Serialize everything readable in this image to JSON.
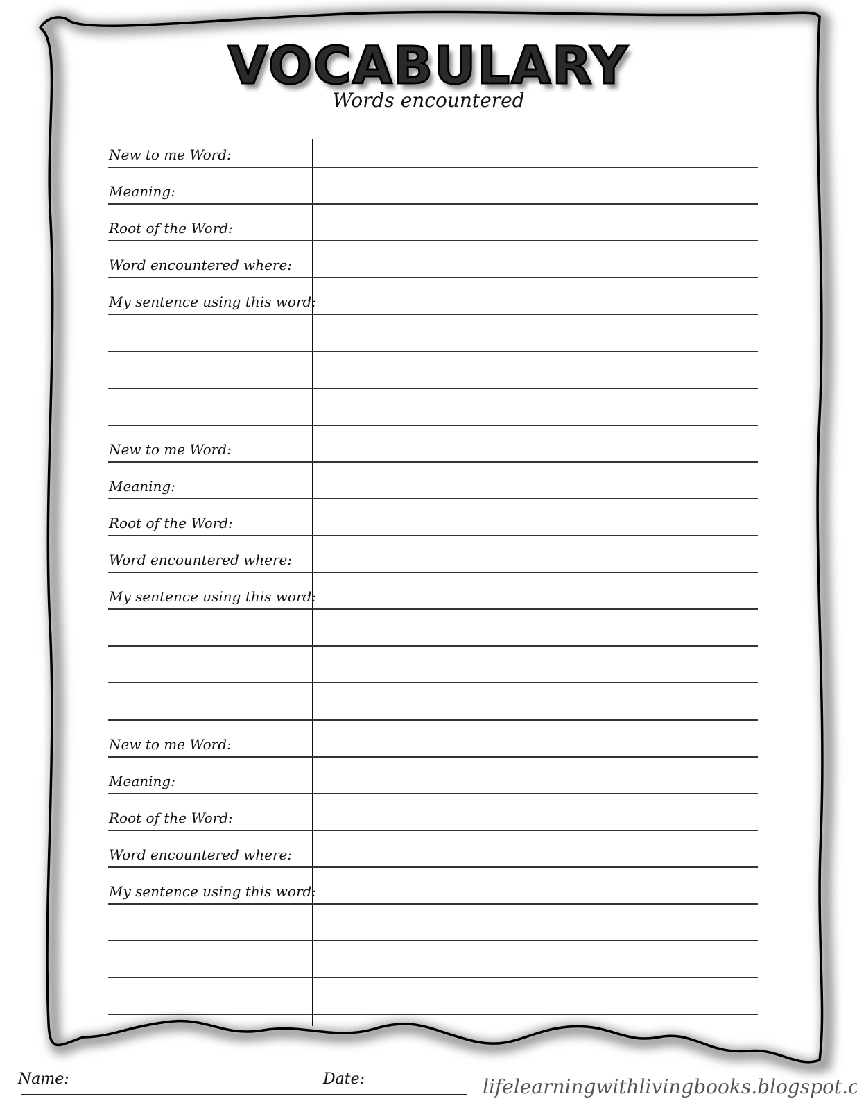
{
  "header": {
    "title": "VOCABULARY",
    "subtitle": "Words encountered"
  },
  "sections": [
    {
      "fields": [
        {
          "label": "New to me Word:"
        },
        {
          "label": "Meaning:"
        },
        {
          "label": "Root of the Word:"
        },
        {
          "label": "Word encountered where:"
        },
        {
          "label": "My sentence using this word:"
        }
      ],
      "extra_lines": 3
    },
    {
      "fields": [
        {
          "label": "New to me Word:"
        },
        {
          "label": "Meaning:"
        },
        {
          "label": "Root of the Word:"
        },
        {
          "label": "Word encountered where:"
        },
        {
          "label": "My sentence using this word:"
        }
      ],
      "extra_lines": 3
    },
    {
      "fields": [
        {
          "label": "New to me Word:"
        },
        {
          "label": "Meaning:"
        },
        {
          "label": "Root of the Word:"
        },
        {
          "label": "Word encountered where:"
        },
        {
          "label": "My sentence using this word:"
        }
      ],
      "extra_lines": 3
    }
  ],
  "footer": {
    "name_label": "Name:",
    "date_label": "Date:",
    "website": "lifelearningwithlivingbooks.blogspot.com"
  },
  "colors": {
    "ink": "#111111",
    "border_shadow": "#9a9a9a"
  }
}
